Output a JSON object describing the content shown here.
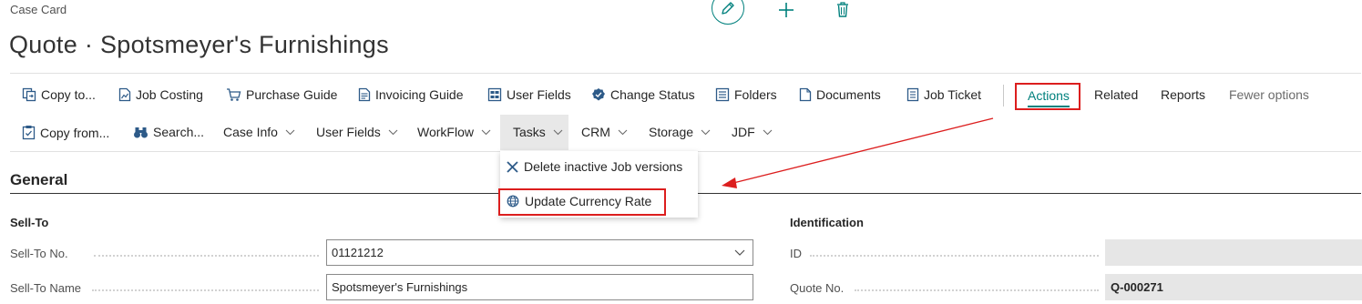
{
  "header": {
    "caption": "Case Card",
    "title": "Quote · Spotsmeyer's Furnishings"
  },
  "actionbar": {
    "row1": [
      {
        "name": "copy-to",
        "label": "Copy to...",
        "icon": "copy-icon"
      },
      {
        "name": "job-costing",
        "label": "Job Costing",
        "icon": "document-chart-icon"
      },
      {
        "name": "purchase-guide",
        "label": "Purchase Guide",
        "icon": "cart-icon"
      },
      {
        "name": "invoicing-guide",
        "label": "Invoicing Guide",
        "icon": "invoice-icon"
      },
      {
        "name": "user-fields",
        "label": "User Fields",
        "icon": "fields-icon"
      },
      {
        "name": "change-status",
        "label": "Change Status",
        "icon": "check-badge-icon"
      },
      {
        "name": "folders",
        "label": "Folders",
        "icon": "folders-icon"
      },
      {
        "name": "documents",
        "label": "Documents",
        "icon": "document-icon"
      },
      {
        "name": "job-ticket",
        "label": "Job Ticket",
        "icon": "ticket-icon"
      }
    ],
    "tabs": {
      "actions": "Actions",
      "related": "Related",
      "reports": "Reports",
      "fewer_options": "Fewer options"
    },
    "row2": [
      {
        "name": "copy-from",
        "label": "Copy from...",
        "icon": "clipboard-check-icon"
      },
      {
        "name": "search",
        "label": "Search...",
        "icon": "binoculars-icon"
      },
      {
        "name": "case-info",
        "label": "Case Info",
        "dropdown": true
      },
      {
        "name": "user-fields-menu",
        "label": "User Fields",
        "dropdown": true
      },
      {
        "name": "workflow",
        "label": "WorkFlow",
        "dropdown": true
      },
      {
        "name": "tasks",
        "label": "Tasks",
        "dropdown": true,
        "active": true
      },
      {
        "name": "crm",
        "label": "CRM",
        "dropdown": true
      },
      {
        "name": "storage",
        "label": "Storage",
        "dropdown": true
      },
      {
        "name": "jdf",
        "label": "JDF",
        "dropdown": true
      }
    ]
  },
  "tasks_menu": {
    "items": [
      {
        "label": "Delete inactive Job versions",
        "icon": "x-icon"
      },
      {
        "label": "Update Currency Rate",
        "icon": "globe-currency-icon"
      }
    ]
  },
  "general": {
    "title": "General",
    "sell_to": {
      "title": "Sell-To",
      "no_label": "Sell-To No.",
      "no_value": "01121212",
      "name_label": "Sell-To Name",
      "name_value": "Spotsmeyer's Furnishings"
    },
    "identification": {
      "title": "Identification",
      "id_label": "ID",
      "id_value": "",
      "quote_label": "Quote No.",
      "quote_value": "Q-000271"
    }
  },
  "colors": {
    "accent": "#00807d",
    "highlight_red": "#dc1e1e"
  }
}
